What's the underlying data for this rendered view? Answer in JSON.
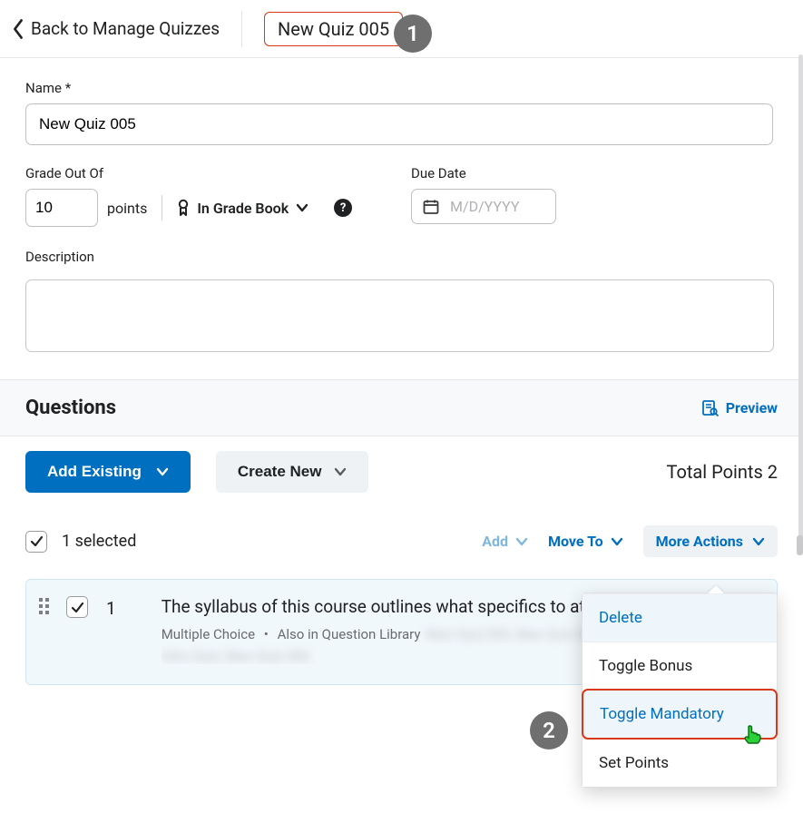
{
  "header": {
    "back_label": "Back to Manage Quizzes",
    "title": "New Quiz 005"
  },
  "callouts": {
    "one": "1",
    "two": "2"
  },
  "form": {
    "name_label": "Name *",
    "name_value": "New Quiz 005",
    "grade_label": "Grade Out Of",
    "grade_points": "10",
    "points_word": "points",
    "gradebook_label": "In Grade Book",
    "due_label": "Due Date",
    "due_placeholder": "M/D/YYYY",
    "desc_label": "Description"
  },
  "questions": {
    "heading": "Questions",
    "preview": "Preview",
    "add_existing": "Add Existing",
    "create_new": "Create New",
    "total_points_label": "Total Points",
    "total_points_value": "2",
    "selected_count": "1 selected",
    "add": "Add",
    "move_to": "Move To",
    "more_actions": "More Actions"
  },
  "question_item": {
    "number": "1",
    "text": "The syllabus of this course outlines what specifics to attending classes?",
    "type": "Multiple Choice",
    "also_in": "Also in Question Library",
    "blur1": "New Quiz 003, New Quiz 004",
    "blur2": "Intro Quiz, New Quiz 006"
  },
  "dropdown": {
    "delete": "Delete",
    "toggle_bonus": "Toggle Bonus",
    "toggle_mandatory": "Toggle Mandatory",
    "set_points": "Set Points"
  }
}
